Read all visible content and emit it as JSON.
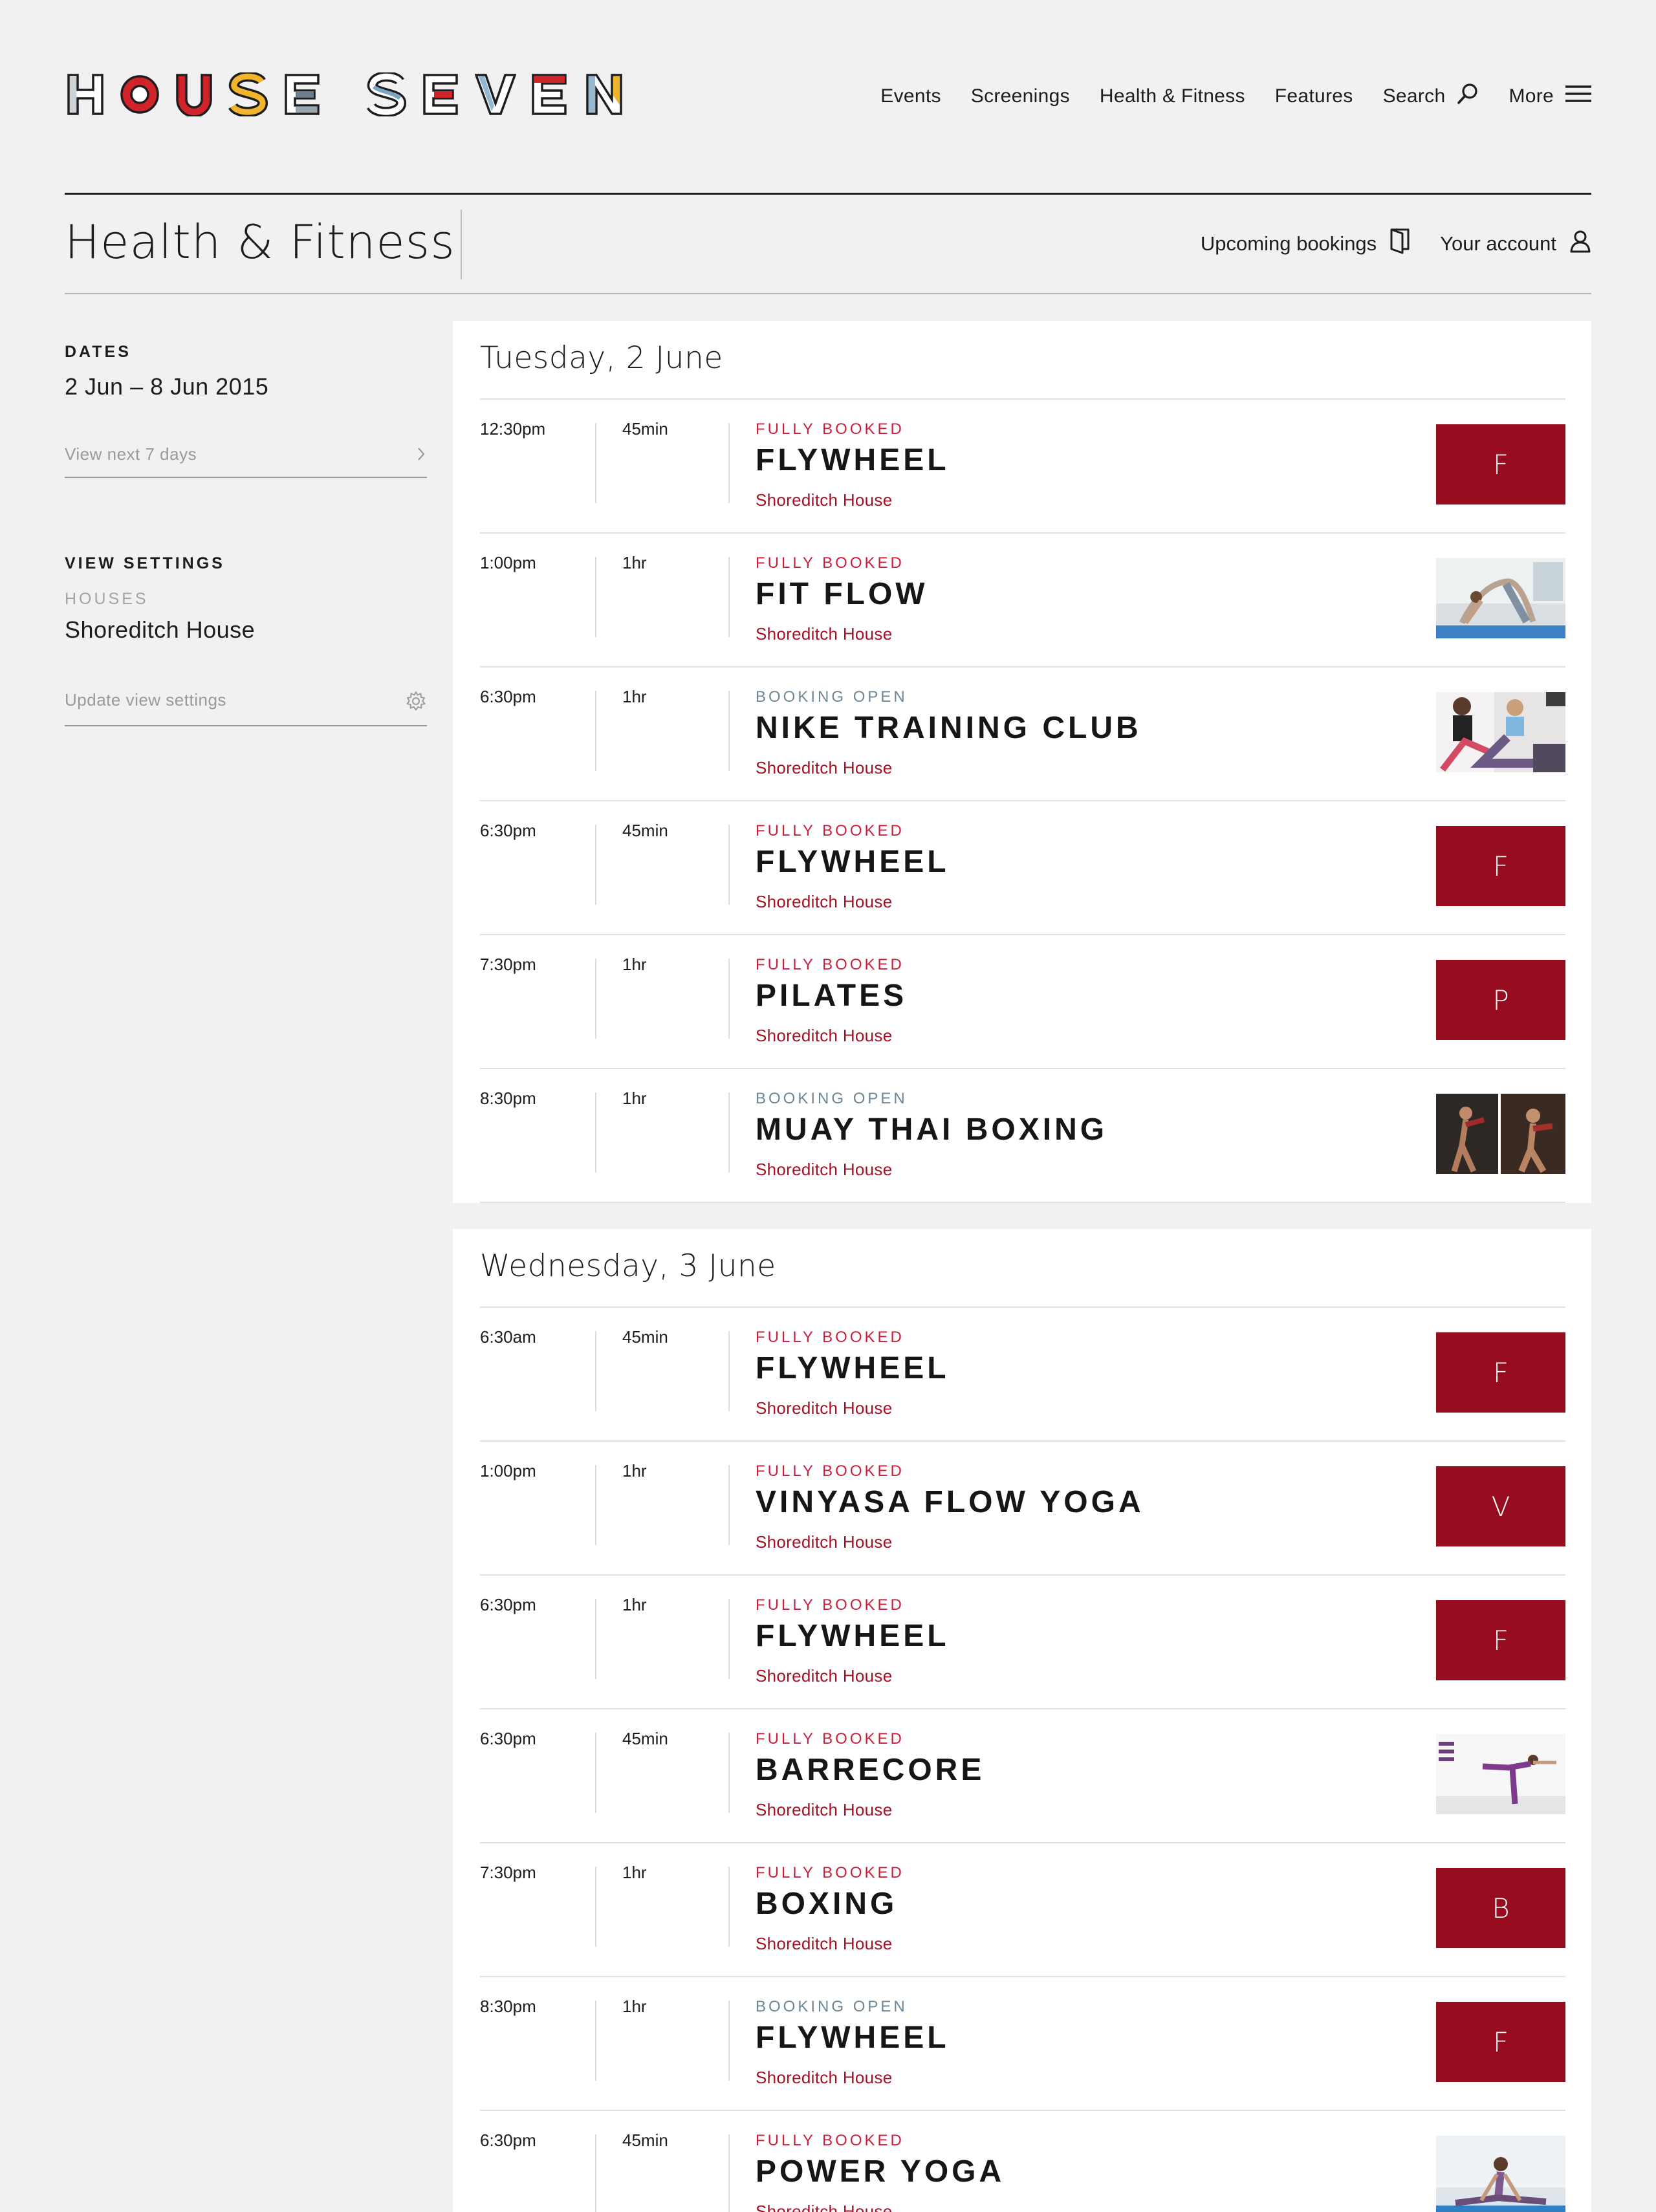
{
  "brand": {
    "name": "HOUSE SEVEN",
    "letters": [
      "H",
      "O",
      "U",
      "S",
      "E",
      "S",
      "E",
      "V",
      "E",
      "N"
    ],
    "colors": {
      "red": "#d1232a",
      "yellow": "#f0b52c",
      "blue": "#7aa6c4",
      "slate": "#6d7d8a",
      "ink": "#1d1d1f"
    }
  },
  "nav": {
    "items": [
      "Events",
      "Screenings",
      "Health & Fitness",
      "Features"
    ],
    "search_label": "Search",
    "search_icon": "search-icon",
    "more_label": "More",
    "more_icon": "menu-icon"
  },
  "page": {
    "title": "Health & Fitness",
    "upcoming_label": "Upcoming bookings",
    "upcoming_icon": "bookings-icon",
    "account_label": "Your account",
    "account_icon": "user-icon"
  },
  "sidebar": {
    "dates_heading": "DATES",
    "dates_value": "2 Jun – 8 Jun 2015",
    "next_days_link": "View next 7 days",
    "view_settings_heading": "VIEW SETTINGS",
    "houses_label": "HOUSES",
    "houses_value": "Shoreditch House",
    "update_link": "Update view settings"
  },
  "days": [
    {
      "title": "Tuesday, 2 June",
      "events": [
        {
          "time": "12:30pm",
          "duration": "45min",
          "status": "FULLY BOOKED",
          "status_type": "booked",
          "name": "FLYWHEEL",
          "house": "Shoreditch House",
          "thumb": "F",
          "thumb_kind": "letter"
        },
        {
          "time": "1:00pm",
          "duration": "1hr",
          "status": "FULLY BOOKED",
          "status_type": "booked",
          "name": "FIT FLOW",
          "house": "Shoreditch House",
          "thumb": "",
          "thumb_kind": "photo-yoga-stretch"
        },
        {
          "time": "6:30pm",
          "duration": "1hr",
          "status": "BOOKING OPEN",
          "status_type": "open",
          "name": "NIKE TRAINING CLUB",
          "house": "Shoreditch House",
          "thumb": "",
          "thumb_kind": "photo-training"
        },
        {
          "time": "6:30pm",
          "duration": "45min",
          "status": "FULLY BOOKED",
          "status_type": "booked",
          "name": "FLYWHEEL",
          "house": "Shoreditch House",
          "thumb": "F",
          "thumb_kind": "letter"
        },
        {
          "time": "7:30pm",
          "duration": "1hr",
          "status": "FULLY BOOKED",
          "status_type": "booked",
          "name": "PILATES",
          "house": "Shoreditch House",
          "thumb": "P",
          "thumb_kind": "letter"
        },
        {
          "time": "8:30pm",
          "duration": "1hr",
          "status": "BOOKING OPEN",
          "status_type": "open",
          "name": "MUAY THAI BOXING",
          "house": "Shoreditch House",
          "thumb": "",
          "thumb_kind": "photo-boxing"
        }
      ]
    },
    {
      "title": "Wednesday, 3 June",
      "events": [
        {
          "time": "6:30am",
          "duration": "45min",
          "status": "FULLY BOOKED",
          "status_type": "booked",
          "name": "FLYWHEEL",
          "house": "Shoreditch House",
          "thumb": "F",
          "thumb_kind": "letter"
        },
        {
          "time": "1:00pm",
          "duration": "1hr",
          "status": "FULLY BOOKED",
          "status_type": "booked",
          "name": "VINYASA FLOW YOGA",
          "house": "Shoreditch House",
          "thumb": "V",
          "thumb_kind": "letter"
        },
        {
          "time": "6:30pm",
          "duration": "1hr",
          "status": "FULLY BOOKED",
          "status_type": "booked",
          "name": "FLYWHEEL",
          "house": "Shoreditch House",
          "thumb": "F",
          "thumb_kind": "letter"
        },
        {
          "time": "6:30pm",
          "duration": "45min",
          "status": "FULLY BOOKED",
          "status_type": "booked",
          "name": "BARRECORE",
          "house": "Shoreditch House",
          "thumb": "",
          "thumb_kind": "photo-barre"
        },
        {
          "time": "7:30pm",
          "duration": "1hr",
          "status": "FULLY BOOKED",
          "status_type": "booked",
          "name": "BOXING",
          "house": "Shoreditch House",
          "thumb": "B",
          "thumb_kind": "letter"
        },
        {
          "time": "8:30pm",
          "duration": "1hr",
          "status": "BOOKING OPEN",
          "status_type": "open",
          "name": "FLYWHEEL",
          "house": "Shoreditch House",
          "thumb": "F",
          "thumb_kind": "letter"
        },
        {
          "time": "6:30pm",
          "duration": "45min",
          "status": "FULLY BOOKED",
          "status_type": "booked",
          "name": "POWER YOGA",
          "house": "Shoreditch House",
          "thumb": "",
          "thumb_kind": "photo-power-yoga"
        }
      ]
    }
  ]
}
